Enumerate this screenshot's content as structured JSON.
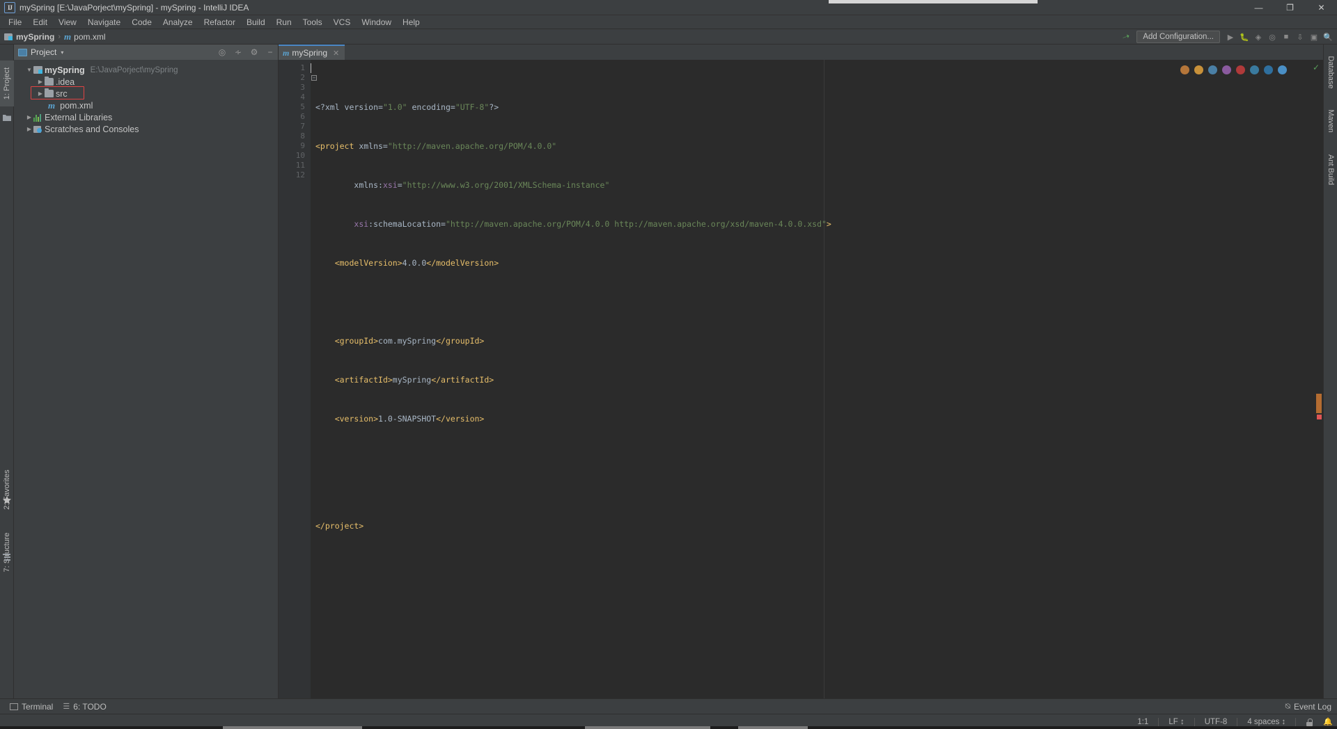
{
  "window": {
    "title": "mySpring [E:\\JavaPorject\\mySpring] - mySpring - IntelliJ IDEA",
    "app_icon": "intellij-idea-icon",
    "minimize": "—",
    "maximize": "❐",
    "close": "✕"
  },
  "menubar": {
    "items": [
      {
        "label": "File"
      },
      {
        "label": "Edit"
      },
      {
        "label": "View"
      },
      {
        "label": "Navigate"
      },
      {
        "label": "Code"
      },
      {
        "label": "Analyze"
      },
      {
        "label": "Refactor"
      },
      {
        "label": "Build"
      },
      {
        "label": "Run"
      },
      {
        "label": "Tools"
      },
      {
        "label": "VCS"
      },
      {
        "label": "Window"
      },
      {
        "label": "Help"
      }
    ]
  },
  "navbar": {
    "breadcrumb": [
      {
        "label": "mySpring",
        "icon": "module-icon"
      },
      {
        "label": "pom.xml",
        "icon": "maven-file-icon"
      }
    ],
    "separator": "›",
    "add_configuration": "Add Configuration...",
    "hammer_icon": "build-hammer-icon",
    "run_icon": "run-icon",
    "debug_icon": "debug-icon",
    "coverage_icon": "coverage-icon",
    "profile_icon": "profile-icon",
    "stop_icon": "stop-icon",
    "updates_icon": "update-icon",
    "layout_icon": "layout-icon",
    "search_icon": "search-icon"
  },
  "left_stripe": {
    "project_tab": "1: Project",
    "favorites_tab": "2: Favorites",
    "structure_tab": "7: Structure",
    "project_icon": "project-folder-icon",
    "star_icon": "star-icon",
    "structure_icon": "structure-icon"
  },
  "project_panel": {
    "title": "Project",
    "title_icon": "project-view-icon",
    "caret": "▾",
    "header_icons": [
      "locate-icon",
      "collapse-all-icon",
      "settings-gear-icon",
      "hide-icon"
    ],
    "tree": [
      {
        "label": "mySpring",
        "path": "E:\\JavaPorject\\mySpring",
        "icon": "module-icon",
        "arrow": "▼",
        "indent": 0,
        "bold": true,
        "selected": false
      },
      {
        "label": ".idea",
        "path": "",
        "icon": "folder-icon",
        "arrow": "▶",
        "indent": 1,
        "bold": false,
        "selected": false
      },
      {
        "label": "src",
        "path": "",
        "icon": "folder-icon",
        "arrow": "▶",
        "indent": 1,
        "bold": false,
        "selected": true
      },
      {
        "label": "pom.xml",
        "path": "",
        "icon": "maven-file-icon",
        "arrow": "",
        "indent": 2,
        "bold": false,
        "selected": false
      },
      {
        "label": "External Libraries",
        "path": "",
        "icon": "library-icon",
        "arrow": "▶",
        "indent": 0,
        "bold": false,
        "selected": false
      },
      {
        "label": "Scratches and Consoles",
        "path": "",
        "icon": "scratches-icon",
        "arrow": "▶",
        "indent": 0,
        "bold": false,
        "selected": false
      }
    ]
  },
  "editor": {
    "tab": {
      "label": "mySpring",
      "icon": "maven-file-icon",
      "close": "✕"
    },
    "line_numbers": [
      "1",
      "2",
      "3",
      "4",
      "5",
      "6",
      "7",
      "8",
      "9",
      "10",
      "11",
      "12"
    ],
    "lines": [
      "<?xml version=\"1.0\" encoding=\"UTF-8\"?>",
      "<project xmlns=\"http://maven.apache.org/POM/4.0.0\"",
      "         xmlns:xsi=\"http://www.w3.org/2001/XMLSchema-instance\"",
      "         xsi:schemaLocation=\"http://maven.apache.org/POM/4.0.0 http://maven.apache.org/xsd/maven-4.0.0.xsd\">",
      "    <modelVersion>4.0.0</modelVersion>",
      "",
      "    <groupId>com.mySpring</groupId>",
      "    <artifactId>mySpring</artifactId>",
      "    <version>1.0-SNAPSHOT</version>",
      "",
      "",
      "</project>"
    ],
    "inspection_status": "✓"
  },
  "right_stripe": {
    "database_tab": "Database",
    "maven_tab": "Maven",
    "ant_build_tab": "Ant Build"
  },
  "bottom_bar": {
    "terminal": "Terminal",
    "terminal_icon": "terminal-icon",
    "todo": "6: TODO",
    "todo_icon": "todo-icon",
    "event_log": "Event Log",
    "event_log_icon": "event-log-icon"
  },
  "status_bar": {
    "caret_position": "1:1",
    "line_separator": "LF",
    "encoding": "UTF-8",
    "indent": "4 spaces",
    "lock_icon": "read-only-lock-icon",
    "notifications_icon": "notifications-icon",
    "separator_caret": "↕"
  }
}
